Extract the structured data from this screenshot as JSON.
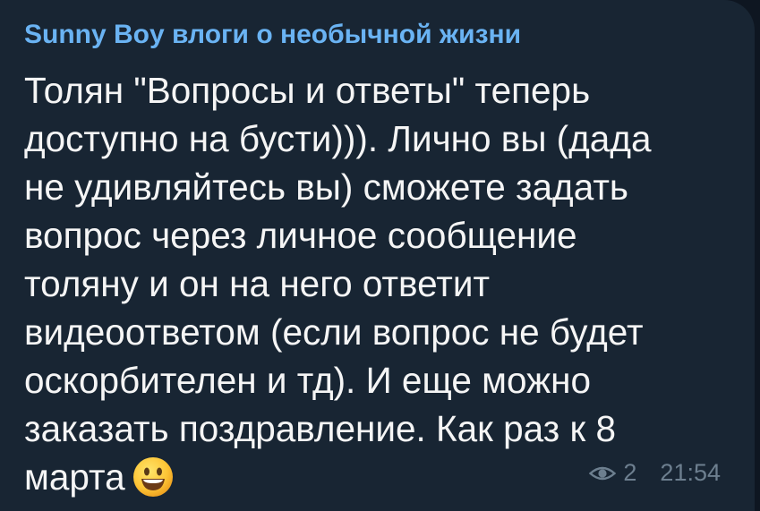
{
  "message": {
    "channel_name": "Sunny Boy влоги о необычной жизни",
    "lines": [
      "Толян \"Вопросы и ответы\" теперь",
      "доступно на бусти))). Лично вы (дада",
      "не удивляйтесь вы) сможете задать",
      "вопрос через личное сообщение",
      "толяну и он на него ответит",
      "видеоответом (если вопрос не будет",
      "оскорбителен и тд). И еще можно",
      "заказать поздравление. Как раз к 8",
      "марта"
    ],
    "emoji": "smiling-face-emoji",
    "views": "2",
    "time": "21:54"
  },
  "colors": {
    "background": "#0e1621",
    "bubble": "#182533",
    "channel_name": "#6ab3f3",
    "text": "#f5f5f5",
    "meta": "#6d7f8f"
  }
}
